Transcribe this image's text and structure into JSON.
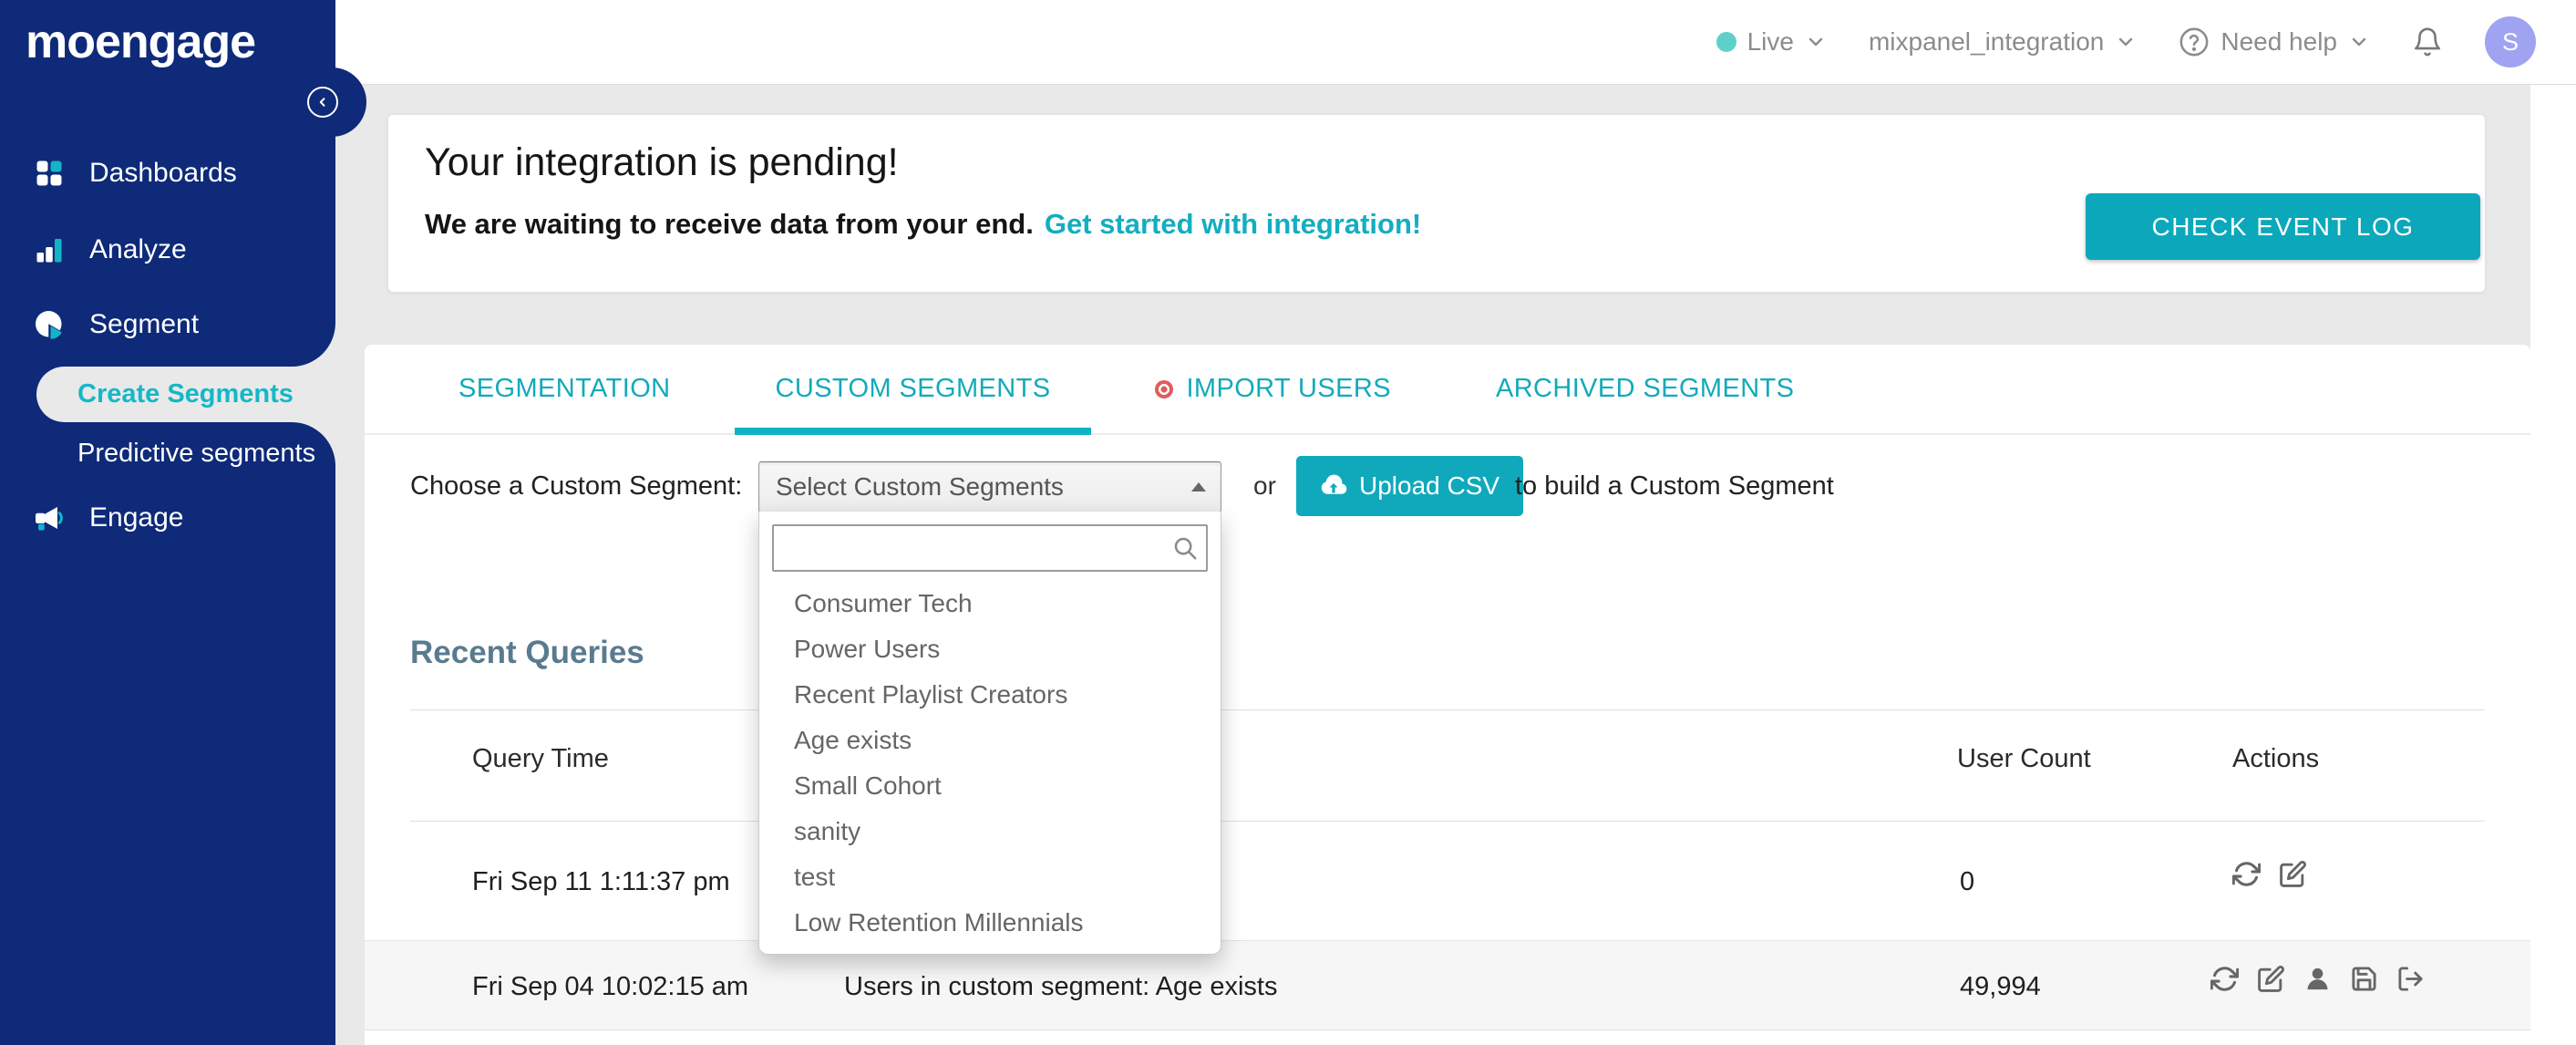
{
  "colors": {
    "sidebar_navy": "#0e2a78",
    "accent_teal": "#10a9bc",
    "live_dot_teal": "#5fd0c8",
    "avatar_purple": "#9fa3f2",
    "badge_red": "#e05d5d",
    "heading_slate": "#5a7b8f",
    "link_teal": "#13aec0"
  },
  "sidebar": {
    "logo": "moengage",
    "items": {
      "dashboards": "Dashboards",
      "analyze": "Analyze",
      "segment": "Segment",
      "engage": "Engage"
    },
    "segment_children": {
      "create_segments": "Create Segments",
      "predictive_segments": "Predictive segments"
    }
  },
  "topbar": {
    "environment": "Live",
    "workspace": "mixpanel_integration",
    "help": "Need help",
    "avatar_initial": "S"
  },
  "banner": {
    "title": "Your integration is pending!",
    "message": "We are waiting to receive data from your end.",
    "link": "Get started with integration!",
    "button": "CHECK EVENT LOG"
  },
  "tabs": {
    "segmentation": "SEGMENTATION",
    "custom_segments": "CUSTOM SEGMENTS",
    "import_users": "IMPORT USERS",
    "archived_segments": "ARCHIVED SEGMENTS"
  },
  "chooser": {
    "label": "Choose a Custom Segment:",
    "select_value": "Select Custom Segments",
    "or": "or",
    "upload_button": "Upload CSV",
    "suffix": "to build a Custom Segment"
  },
  "dropdown": {
    "options": [
      "Consumer Tech",
      "Power Users",
      "Recent Playlist Creators",
      "Age exists",
      "Small Cohort",
      "sanity",
      "test",
      "Low Retention Millennials"
    ]
  },
  "recent_queries": {
    "title": "Recent Queries",
    "columns": {
      "query_time": "Query Time",
      "user_count": "User Count",
      "actions": "Actions"
    },
    "rows": [
      {
        "query_time": "Fri Sep 11 1:11:37 pm",
        "query": "",
        "user_count": "0",
        "actions": [
          "refresh",
          "edit"
        ]
      },
      {
        "query_time": "Fri Sep 04 10:02:15 am",
        "query": "Users in custom segment: Age exists",
        "user_count": "49,994",
        "actions": [
          "refresh",
          "edit",
          "user",
          "save",
          "export"
        ]
      }
    ]
  }
}
